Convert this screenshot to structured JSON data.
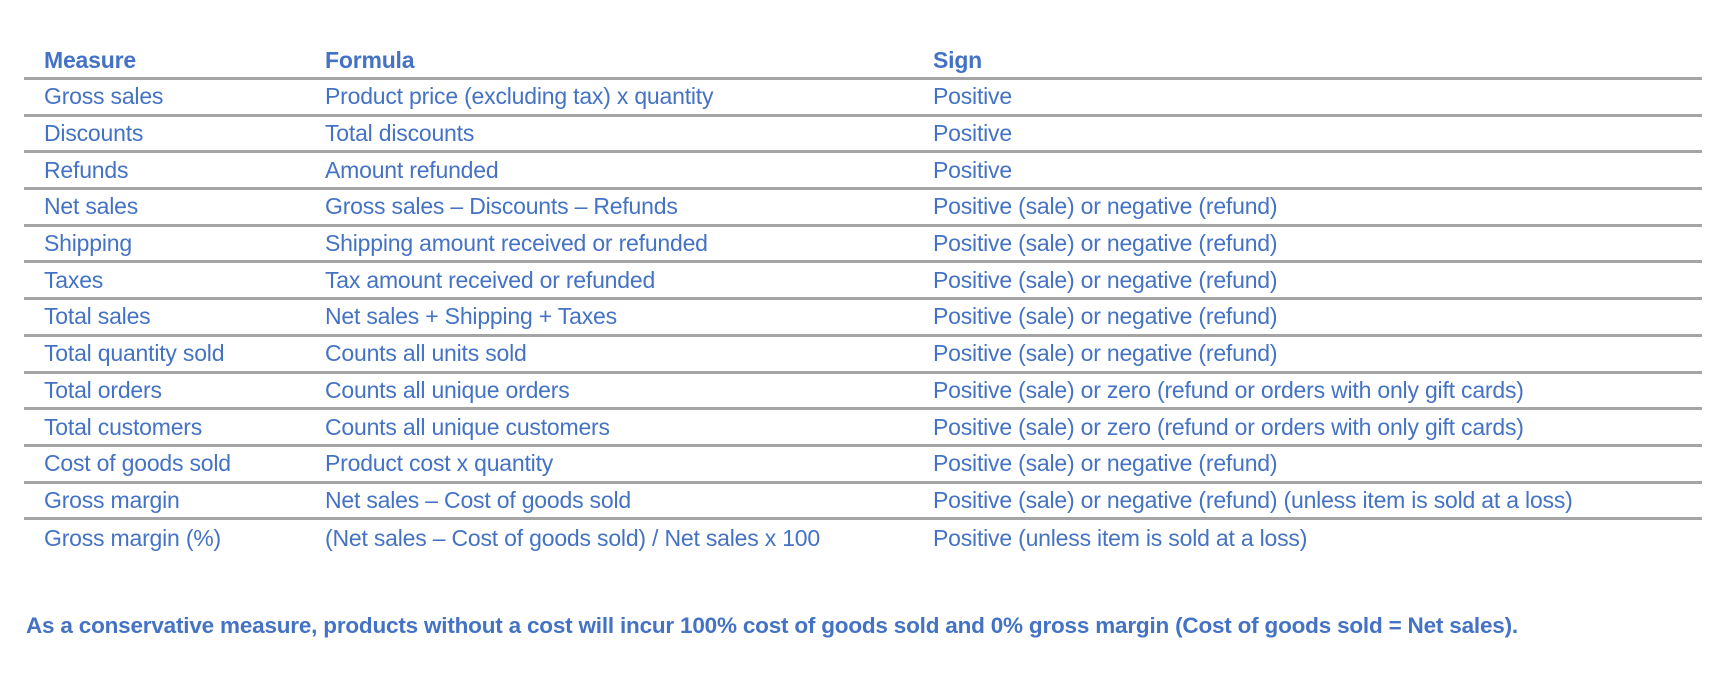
{
  "table": {
    "headers": [
      "Measure",
      "Formula",
      "Sign"
    ],
    "rows": [
      {
        "measure": "Gross sales",
        "formula": "Product price (excluding tax) x quantity",
        "sign": "Positive"
      },
      {
        "measure": "Discounts",
        "formula": "Total discounts",
        "sign": "Positive"
      },
      {
        "measure": "Refunds",
        "formula": "Amount refunded",
        "sign": "Positive"
      },
      {
        "measure": "Net sales",
        "formula": "Gross sales – Discounts – Refunds",
        "sign": "Positive (sale) or negative (refund)"
      },
      {
        "measure": "Shipping",
        "formula": "Shipping amount received or refunded",
        "sign": "Positive (sale) or negative (refund)"
      },
      {
        "measure": "Taxes",
        "formula": "Tax amount received or refunded",
        "sign": "Positive (sale) or negative (refund)"
      },
      {
        "measure": "Total sales",
        "formula": "Net sales + Shipping + Taxes",
        "sign": "Positive (sale) or negative (refund)"
      },
      {
        "measure": "Total quantity sold",
        "formula": "Counts all units sold",
        "sign": "Positive (sale) or negative (refund)"
      },
      {
        "measure": "Total orders",
        "formula": "Counts all unique orders",
        "sign": "Positive (sale) or zero (refund or orders with only gift cards)"
      },
      {
        "measure": "Total customers",
        "formula": "Counts all unique customers",
        "sign": "Positive (sale) or zero (refund or orders with only gift cards)"
      },
      {
        "measure": "Cost of goods sold",
        "formula": "Product cost x quantity",
        "sign": "Positive (sale) or negative (refund)"
      },
      {
        "measure": "Gross margin",
        "formula": "Net sales – Cost of goods sold",
        "sign": "Positive (sale) or negative (refund) (unless item is sold at a loss)"
      },
      {
        "measure": "Gross margin (%)",
        "formula": "(Net sales – Cost of goods sold) / Net sales x 100",
        "sign": "Positive (unless item is sold at a loss)"
      }
    ]
  },
  "note": "As a conservative measure, products without a cost will incur 100% cost of goods sold and 0% gross margin (Cost of goods sold = Net sales).",
  "colors": {
    "text": "#4472C4",
    "rule": "#A5A5A5"
  }
}
